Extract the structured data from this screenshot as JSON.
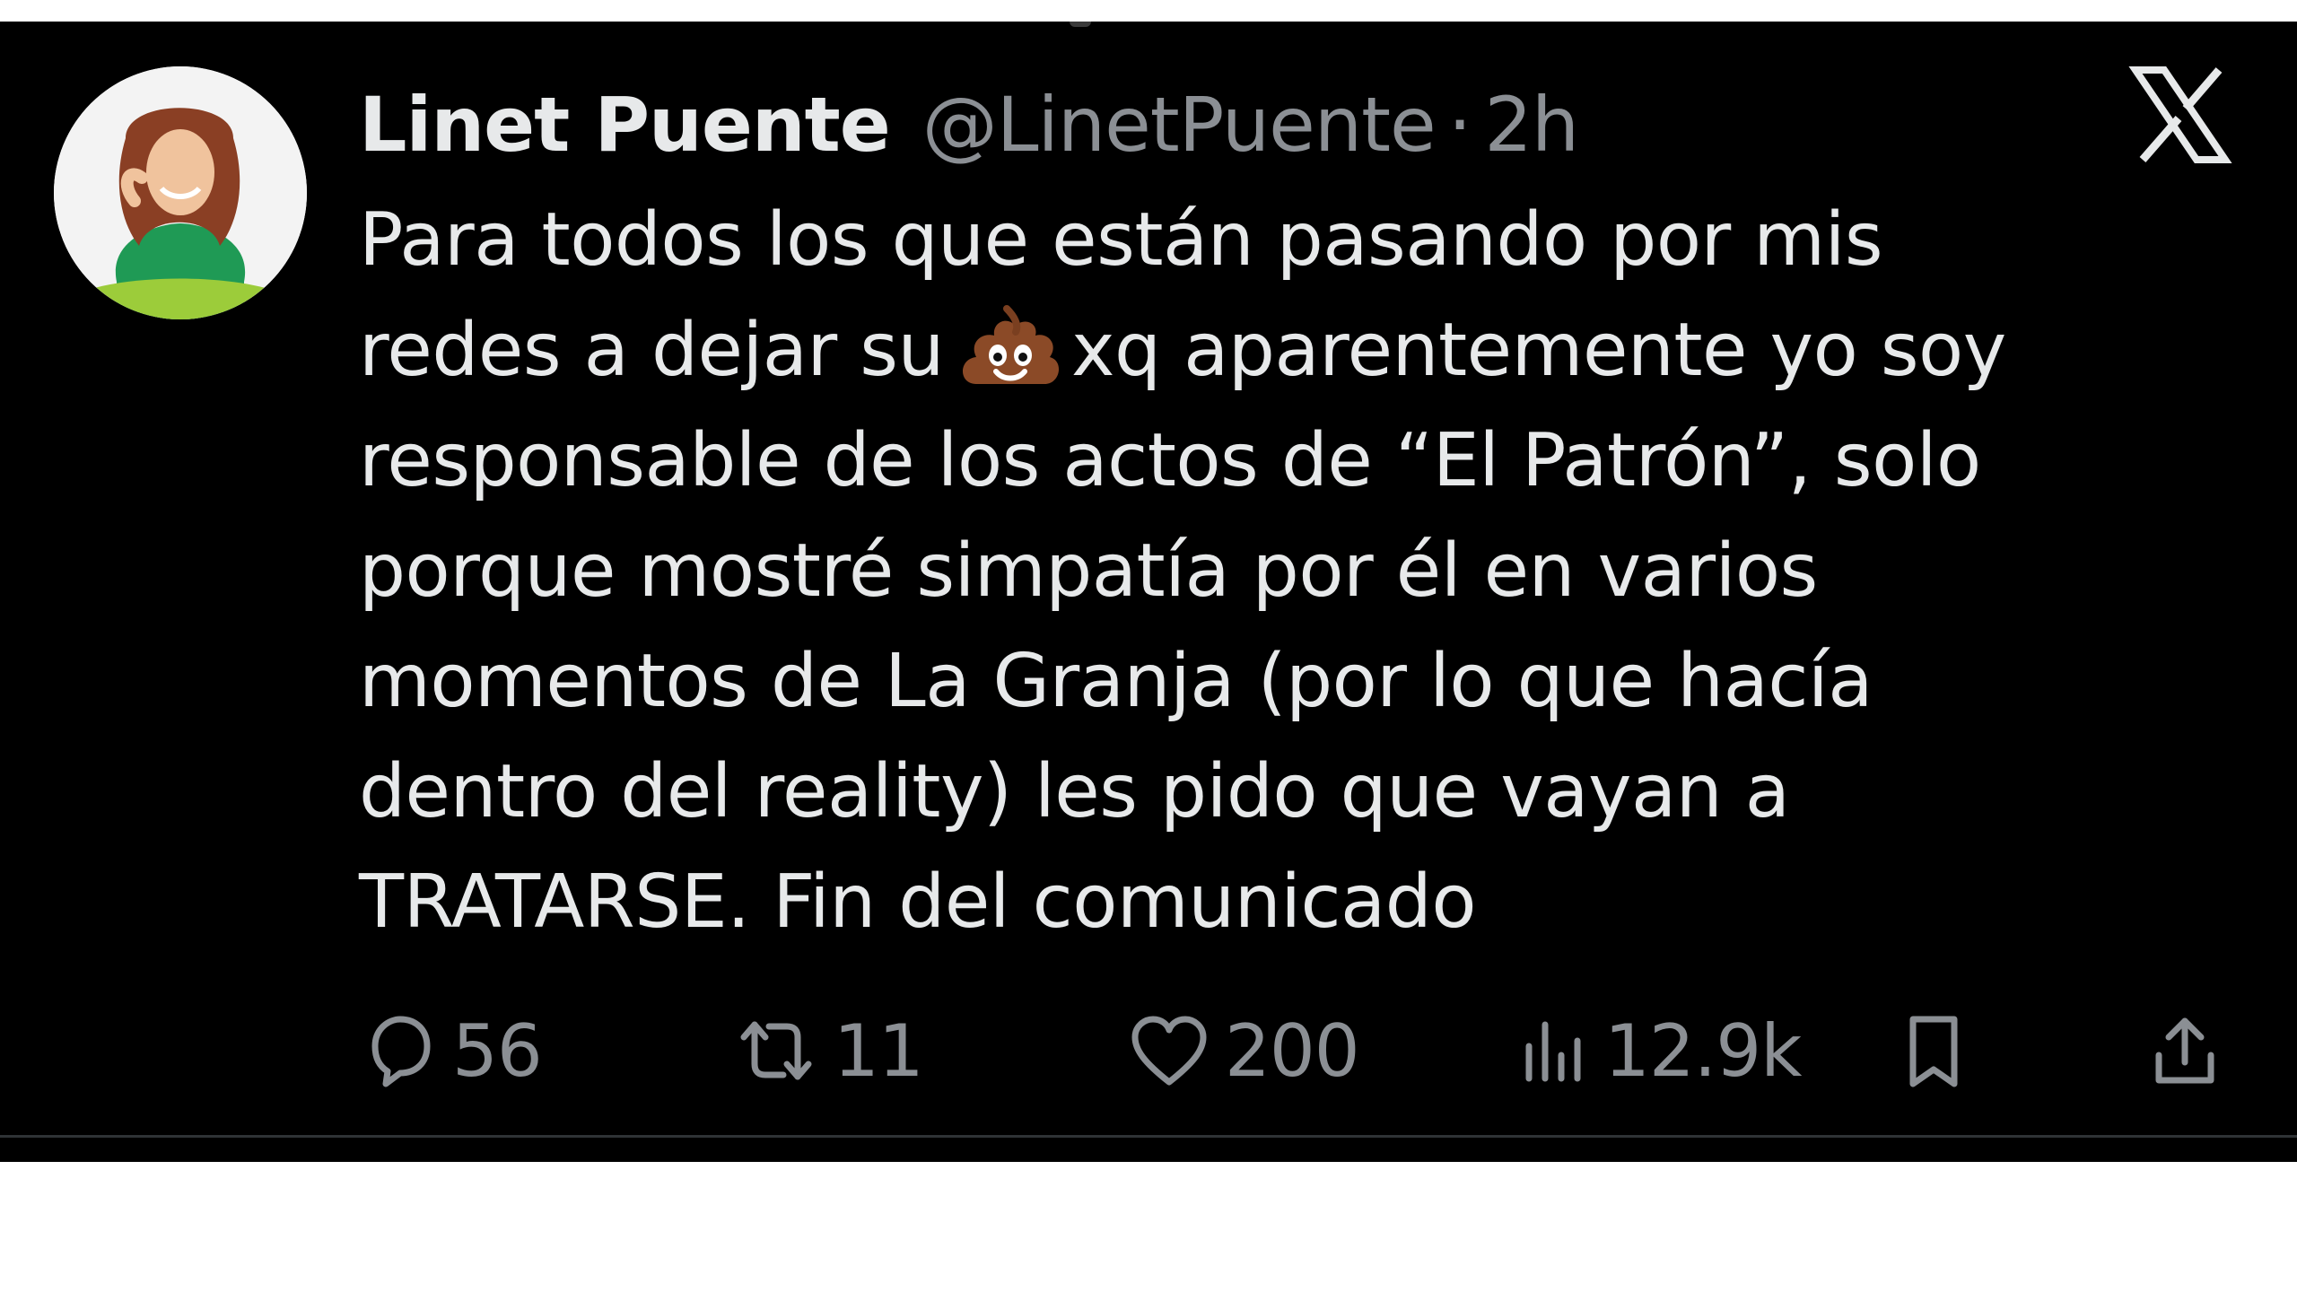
{
  "tweet": {
    "author": {
      "display_name": "Linet Puente",
      "handle": "@LinetPuente",
      "avatar_icon": "profile-photo"
    },
    "separator": "·",
    "time": "2h",
    "platform_logo": "x-logo-icon",
    "text_lines": [
      {
        "before": "Para todos los que están pasando por mis"
      },
      {
        "before": "redes a dejar su",
        "emoji": "pile-of-poo",
        "after": "xq aparentemente yo soy"
      },
      {
        "before": "responsable de los actos de “El Patrón”, solo"
      },
      {
        "before": "porque mostré simpatía por él en varios"
      },
      {
        "before": "momentos de La Granja (por lo que hacía"
      },
      {
        "before": "dentro del reality) les pido que vayan a"
      },
      {
        "before": "TRATARSE. Fin del comunicado"
      }
    ],
    "actions": {
      "replies": {
        "icon": "reply-icon",
        "count": "56"
      },
      "reposts": {
        "icon": "repost-icon",
        "count": "11"
      },
      "likes": {
        "icon": "heart-icon",
        "count": "200"
      },
      "views": {
        "icon": "views-icon",
        "count": "12.9k"
      },
      "bookmark": {
        "icon": "bookmark-icon"
      },
      "share": {
        "icon": "share-icon"
      }
    },
    "colors": {
      "background": "#000000",
      "primary_text": "#e7e9ea",
      "secondary_text": "#8b8f94",
      "divider": "#2f3336"
    }
  }
}
